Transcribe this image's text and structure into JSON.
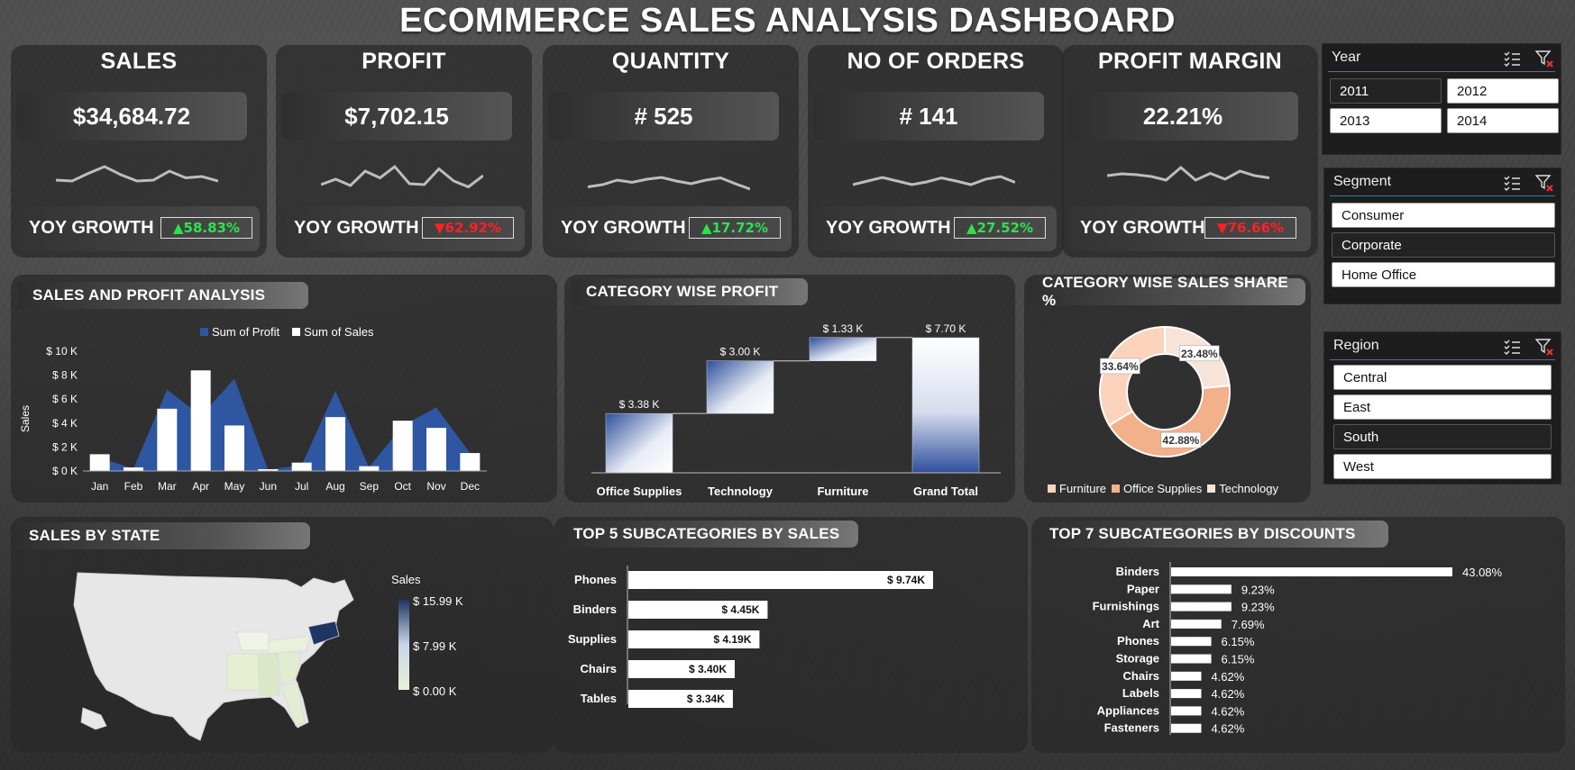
{
  "title": "ECOMMERCE SALES ANALYSIS DASHBOARD",
  "kpis": [
    {
      "title": "SALES",
      "value": "$34,684.72",
      "yoy_label": "YOY GROWTH",
      "yoy": "▲58.83%",
      "dir": "up"
    },
    {
      "title": "PROFIT",
      "value": "$7,702.15",
      "yoy_label": "YOY GROWTH",
      "yoy": "▼62.92%",
      "dir": "down"
    },
    {
      "title": "QUANTITY",
      "value": "# 525",
      "yoy_label": "YOY GROWTH",
      "yoy": "▲17.72%",
      "dir": "up"
    },
    {
      "title": "NO OF ORDERS",
      "value": "# 141",
      "yoy_label": "YOY GROWTH",
      "yoy": "▲27.52%",
      "dir": "up"
    },
    {
      "title": "PROFIT MARGIN",
      "value": "22.21%",
      "yoy_label": "YOY GROWTH",
      "yoy": "▼76.66%",
      "dir": "down"
    }
  ],
  "slicers": {
    "year": {
      "title": "Year",
      "items": [
        {
          "label": "2011",
          "selected": false
        },
        {
          "label": "2012",
          "selected": true
        },
        {
          "label": "2013",
          "selected": true
        },
        {
          "label": "2014",
          "selected": true
        }
      ]
    },
    "segment": {
      "title": "Segment",
      "items": [
        {
          "label": "Consumer",
          "selected": true
        },
        {
          "label": "Corporate",
          "selected": false
        },
        {
          "label": "Home Office",
          "selected": true
        }
      ]
    },
    "region": {
      "title": "Region",
      "items": [
        {
          "label": "Central",
          "selected": true
        },
        {
          "label": "East",
          "selected": true
        },
        {
          "label": "South",
          "selected": false
        },
        {
          "label": "West",
          "selected": true
        }
      ]
    }
  },
  "sections": {
    "sales_profit": "SALES AND PROFIT ANALYSIS",
    "category_profit": "CATEGORY WISE PROFIT",
    "category_share": "CATEGORY WISE SALES SHARE %",
    "sales_by_state": "SALES BY STATE",
    "top5": "TOP 5 SUBCATEGORIES BY SALES",
    "top7": "TOP 7 SUBCATEGORIES BY DISCOUNTS"
  },
  "colors": {
    "profit_blue": "#2f56a0",
    "sales_white": "#ffffff",
    "furniture": "#fbd3bd",
    "office_supplies": "#f2b08b",
    "technology": "#f7e3d8"
  },
  "chart_data": [
    {
      "id": "sales_profit",
      "type": "bar",
      "legend": [
        "Sum of Profit",
        "Sum of Sales"
      ],
      "ylabel": "Sales",
      "yticks": [
        "$ 0 K",
        "$ 2 K",
        "$ 4 K",
        "$ 6 K",
        "$ 8 K",
        "$ 10 K"
      ],
      "ylim": [
        0,
        10000
      ],
      "categories": [
        "Jan",
        "Feb",
        "Mar",
        "Apr",
        "May",
        "Jun",
        "Jul",
        "Aug",
        "Sep",
        "Oct",
        "Nov",
        "Dec"
      ],
      "series": [
        {
          "name": "Sum of Sales",
          "values": [
            1400,
            300,
            5200,
            8400,
            3800,
            150,
            700,
            4500,
            400,
            4200,
            3600,
            1500
          ]
        },
        {
          "name": "Sum of Profit",
          "values": [
            1100,
            200,
            6800,
            4600,
            7700,
            100,
            500,
            6700,
            300,
            3800,
            5300,
            1500
          ]
        }
      ]
    },
    {
      "id": "category_profit",
      "type": "bar",
      "subtype": "waterfall",
      "categories": [
        "Office Supplies",
        "Technology",
        "Furniture",
        "Grand Total"
      ],
      "values": [
        3380,
        3000,
        1330,
        7700
      ],
      "labels": [
        "$ 3.38 K",
        "$ 3.00 K",
        "$ 1.33 K",
        "$ 7.70 K"
      ]
    },
    {
      "id": "category_share",
      "type": "pie",
      "subtype": "donut",
      "categories": [
        "Furniture",
        "Office Supplies",
        "Technology"
      ],
      "values": [
        33.64,
        42.88,
        23.48
      ],
      "labels": [
        "33.64%",
        "42.88%",
        "23.48%"
      ]
    },
    {
      "id": "top5",
      "type": "bar",
      "orientation": "horizontal",
      "categories": [
        "Phones",
        "Binders",
        "Supplies",
        "Chairs",
        "Tables"
      ],
      "values": [
        9.74,
        4.45,
        4.19,
        3.4,
        3.34
      ],
      "labels": [
        "$ 9.74K",
        "$ 4.45K",
        "$ 4.19K",
        "$ 3.40K",
        "$ 3.34K"
      ]
    },
    {
      "id": "top7",
      "type": "bar",
      "orientation": "horizontal",
      "categories": [
        "Binders",
        "Paper",
        "Furnishings",
        "Art",
        "Phones",
        "Storage",
        "Chairs",
        "Labels",
        "Appliances",
        "Fasteners"
      ],
      "values": [
        43.08,
        9.23,
        9.23,
        7.69,
        6.15,
        6.15,
        4.62,
        4.62,
        4.62,
        4.62
      ],
      "labels": [
        "43.08%",
        "9.23%",
        "9.23%",
        "7.69%",
        "6.15%",
        "6.15%",
        "4.62%",
        "4.62%",
        "4.62%",
        "4.62%"
      ]
    }
  ],
  "map": {
    "legend_title": "Sales",
    "legend_ticks": [
      "$ 15.99 K",
      "$ 7.99 K",
      "$ 0.00 K"
    ]
  }
}
